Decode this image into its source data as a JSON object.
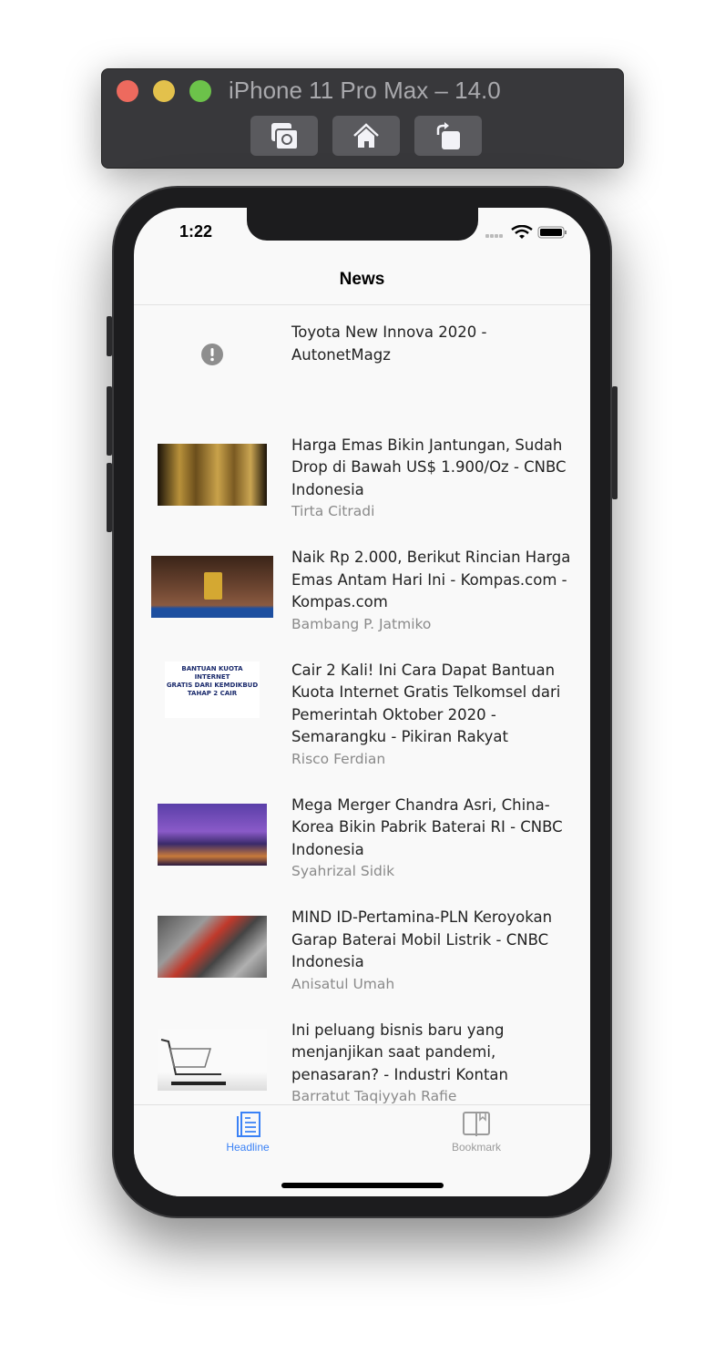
{
  "window": {
    "title": "iPhone 11 Pro Max – 14.0",
    "buttons": [
      "screenshot-icon",
      "home-icon",
      "rotate-icon"
    ]
  },
  "status": {
    "time": "1:22"
  },
  "nav": {
    "title": "News"
  },
  "articles": [
    {
      "title": "Toyota New Innova 2020 - AutonetMagz",
      "author": "",
      "image": "error-icon"
    },
    {
      "title": "Harga Emas Bikin Jantungan, Sudah Drop di Bawah US$ 1.900/Oz - CNBC Indonesia",
      "author": "Tirta Citradi"
    },
    {
      "title": "Naik Rp 2.000, Berikut Rincian Harga Emas Antam Hari Ini - Kompas.com - Kompas.com",
      "author": "Bambang P. Jatmiko"
    },
    {
      "title": "Cair 2 Kali! Ini Cara Dapat Bantuan Kuota Internet Gratis Telkomsel dari Pemerintah Oktober 2020 - Semarangku - Pikiran Rakyat",
      "author": "Risco Ferdian"
    },
    {
      "title": "Mega Merger Chandra Asri, China-Korea Bikin Pabrik Baterai RI - CNBC Indonesia",
      "author": "Syahrizal Sidik"
    },
    {
      "title": "MIND ID-Pertamina-PLN Keroyokan Garap Baterai Mobil Listrik - CNBC Indonesia",
      "author": "Anisatul Umah"
    },
    {
      "title": "Ini peluang bisnis baru yang menjanjikan saat pandemi, penasaran? - Industri Kontan",
      "author": "Barratut Taqiyyah Rafie"
    }
  ],
  "tabs": [
    {
      "label": "Headline",
      "active": true
    },
    {
      "label": "Bookmark",
      "active": false
    }
  ],
  "colors": {
    "accent": "#3b82f6",
    "inactive": "#9b9b9b"
  }
}
